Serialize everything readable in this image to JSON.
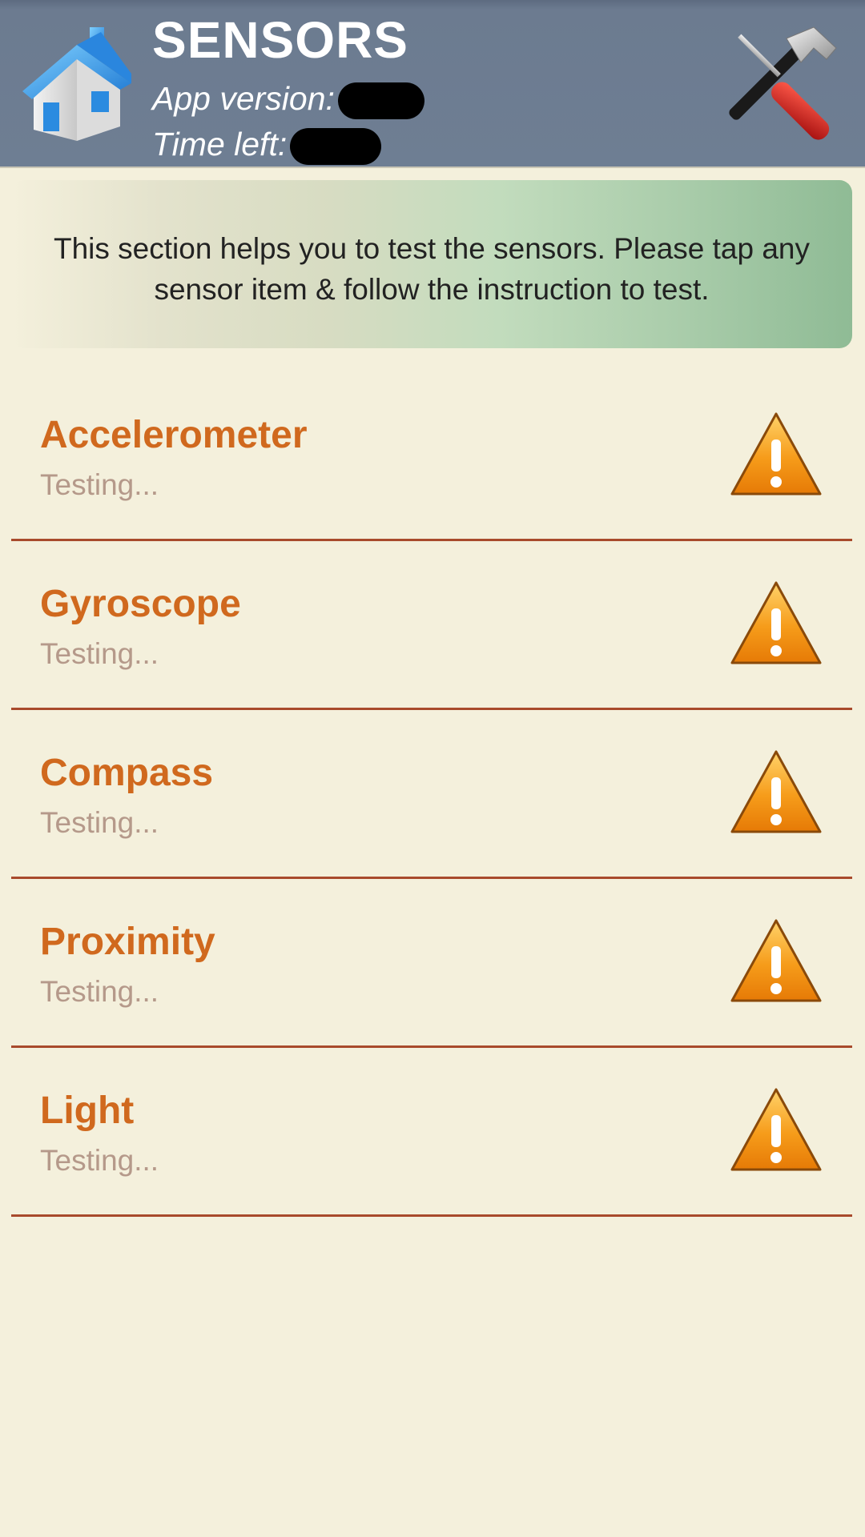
{
  "header": {
    "title": "SENSORS",
    "app_version_label": "App version:",
    "time_left_label": "Time left:",
    "home_icon": "home-icon",
    "tools_icon": "tools-icon"
  },
  "banner": {
    "text": "This section helps you to test the sensors. Please tap any sensor item & follow the instruction to test."
  },
  "sensors": [
    {
      "name": "Accelerometer",
      "status": "Testing...",
      "icon": "warning-icon"
    },
    {
      "name": "Gyroscope",
      "status": "Testing...",
      "icon": "warning-icon"
    },
    {
      "name": "Compass",
      "status": "Testing...",
      "icon": "warning-icon"
    },
    {
      "name": "Proximity",
      "status": "Testing...",
      "icon": "warning-icon"
    },
    {
      "name": "Light",
      "status": "Testing...",
      "icon": "warning-icon"
    }
  ],
  "colors": {
    "header_bg": "#6e7e93",
    "page_bg": "#f4f0dc",
    "sensor_name": "#d0691e",
    "sensor_status": "#b5998a",
    "divider": "#a84a2c",
    "warning": "#f39a12"
  }
}
